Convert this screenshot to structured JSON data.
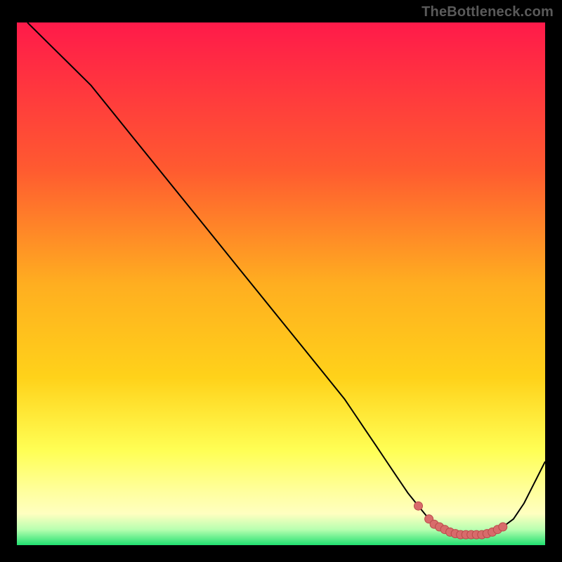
{
  "attribution": "TheBottleneck.com",
  "colors": {
    "gradient_top": "#ff1a4a",
    "gradient_mid1": "#ff7a2a",
    "gradient_mid2": "#ffd21a",
    "gradient_low": "#ffff55",
    "gradient_pale": "#ffffc0",
    "gradient_green": "#20e070",
    "curve": "#000000",
    "marker_fill": "#d86b6b",
    "marker_stroke": "#b94a4a",
    "frame_bg": "#000000"
  },
  "chart_data": {
    "type": "line",
    "title": "",
    "xlabel": "",
    "ylabel": "",
    "xlim": [
      0,
      100
    ],
    "ylim": [
      0,
      100
    ],
    "series": [
      {
        "name": "bottleneck-curve",
        "x": [
          2,
          6,
          10,
          14,
          18,
          22,
          26,
          30,
          34,
          38,
          42,
          46,
          50,
          54,
          58,
          62,
          64,
          66,
          68,
          70,
          72,
          74,
          76,
          78,
          80,
          82,
          84,
          86,
          88,
          90,
          92,
          94,
          96,
          98,
          100
        ],
        "y": [
          100,
          96,
          92,
          88,
          83,
          78,
          73,
          68,
          63,
          58,
          53,
          48,
          43,
          38,
          33,
          28,
          25,
          22,
          19,
          16,
          13,
          10,
          7.5,
          5,
          3.5,
          2.5,
          2,
          2,
          2,
          2.5,
          3.5,
          5,
          8,
          12,
          16
        ]
      }
    ],
    "markers": {
      "name": "highlight-points",
      "x": [
        76,
        78,
        79,
        80,
        81,
        82,
        83,
        84,
        85,
        86,
        87,
        88,
        89,
        90,
        91,
        92
      ],
      "y": [
        7.5,
        5,
        4,
        3.5,
        3,
        2.5,
        2.2,
        2,
        2,
        2,
        2,
        2,
        2.2,
        2.5,
        3,
        3.5
      ]
    }
  }
}
